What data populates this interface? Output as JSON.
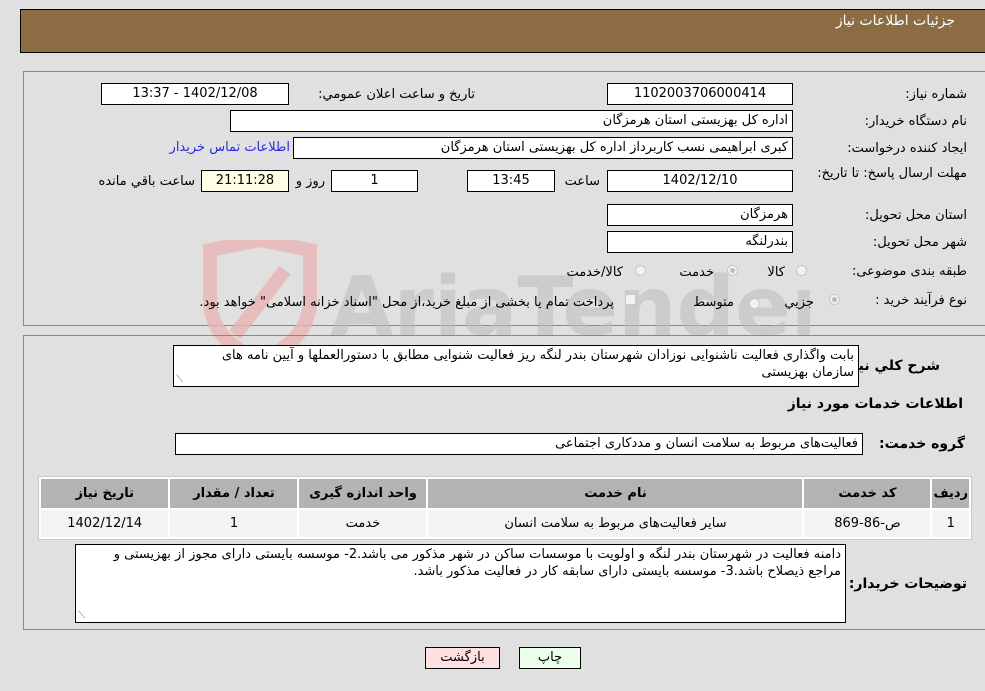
{
  "header": {
    "title": "جزئیات اطلاعات نیاز"
  },
  "form": {
    "need_number": {
      "label": "شماره نیاز:",
      "value": "1102003706000414"
    },
    "announce_datetime": {
      "label": "تاریخ و ساعت اعلان عمومي:",
      "value": "1402/12/08 - 13:37"
    },
    "buyer_org": {
      "label": "نام دستگاه خریدار:",
      "value": "اداره کل بهزیستی استان هرمزگان"
    },
    "requester": {
      "label": "ایجاد کننده درخواست:",
      "value": "کبری  ابراهیمی نسب کاربرداز اداره کل بهزیستی استان هرمزگان"
    },
    "buyer_contact_link": "اطلاعات تماس خریدار",
    "deadline": {
      "label": "مهلت ارسال پاسخ: تا تاریخ:",
      "date": "1402/12/10",
      "time_label": "ساعت",
      "time": "13:45",
      "days": "1",
      "days_label": "روز و",
      "remaining": "21:11:28",
      "remaining_label": "ساعت باقي مانده"
    },
    "province": {
      "label": "استان محل تحویل:",
      "value": "هرمزگان"
    },
    "city": {
      "label": "شهر محل تحویل:",
      "value": "بندرلنگه"
    },
    "category": {
      "label": "طبقه بندی موضوعی:",
      "options": [
        "کالا",
        "خدمت",
        "کالا/خدمت"
      ],
      "selected": "خدمت"
    },
    "purchase_type": {
      "label": "نوع فرآیند خرید :",
      "options": [
        "جزيي",
        "متوسط"
      ],
      "selected": "جزيي",
      "treasury_note": "پرداخت تمام یا بخشی از مبلغ خرید،از محل \"اسناد خزانه اسلامی\" خواهد بود."
    }
  },
  "description": {
    "label": "شرح کلي نیاز:",
    "value": "بابت واگذاری فعالیت ناشنوایی نوزادان شهرستان بندر لنگه ریز فعالیت شنوایی مطابق با دستورالعملها و آیین نامه های سازمان بهزیستی"
  },
  "services": {
    "section_title": "اطلاعات خدمات مورد نیاز",
    "group_label": "گروه خدمت:",
    "group_value": "فعالیت‌های مربوط به سلامت انسان و مددکاری اجتماعی",
    "table": {
      "headers": [
        "ردیف",
        "کد خدمت",
        "نام خدمت",
        "واحد اندازه گیری",
        "تعداد / مقدار",
        "تاریخ نیاز"
      ],
      "rows": [
        [
          "1",
          "ص-86-869",
          "سایر فعالیت‌های مربوط به سلامت انسان",
          "خدمت",
          "1",
          "1402/12/14"
        ]
      ]
    }
  },
  "buyer_notes": {
    "label": "توضیحات خریدار:",
    "value": "دامنه فعالیت در شهرستان بندر لنگه و اولویت با موسسات ساکن در شهر مذکور می باشد.2- موسسه بایستی دارای مجوز از بهزیستی و مراجع ذیصلاح باشد.3- موسسه بایستی دارای سابقه کار در فعالیت مذکور باشد."
  },
  "buttons": {
    "print": "چاپ",
    "back": "بازگشت"
  },
  "watermark": {
    "text": "AriaTender.neT"
  },
  "colors": {
    "header_bg": "#8c6d43",
    "link": "#2a2ae0",
    "print_bg": "#ebffeb",
    "back_bg": "#ffe0e0",
    "remaining_bg": "#ffffe6"
  }
}
